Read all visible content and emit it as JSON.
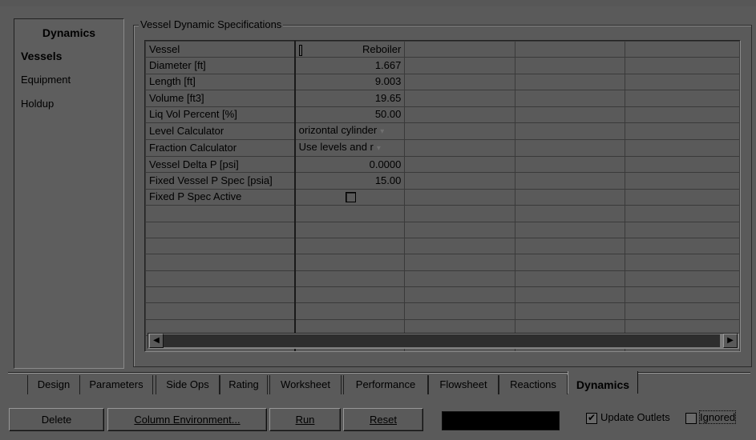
{
  "nav": {
    "header": "Dynamics",
    "items": [
      {
        "label": "Vessels",
        "selected": true
      },
      {
        "label": "Equipment",
        "selected": false
      },
      {
        "label": "Holdup",
        "selected": false
      }
    ]
  },
  "group": {
    "title": "Vessel Dynamic Specifications"
  },
  "grid": {
    "rows": [
      {
        "label": "Vessel",
        "value": "Reboiler"
      },
      {
        "label": "Diameter [ft]",
        "value": "1.667"
      },
      {
        "label": "Length [ft]",
        "value": "9.003"
      },
      {
        "label": "Volume [ft3]",
        "value": "19.65"
      },
      {
        "label": "Liq Vol Percent [%]",
        "value": "50.00"
      },
      {
        "label": "Level Calculator",
        "value": "orizontal cylinder"
      },
      {
        "label": "Fraction Calculator",
        "value": "Use levels and r"
      },
      {
        "label": "Vessel Delta P [psi]",
        "value": "0.0000"
      },
      {
        "label": "Fixed Vessel P Spec [psia]",
        "value": "15.00"
      },
      {
        "label": "Fixed P Spec Active",
        "value": ""
      }
    ],
    "fixed_p_spec_active": false
  },
  "tabs": [
    {
      "label": "Design"
    },
    {
      "label": "Parameters"
    },
    {
      "label": "Side Ops"
    },
    {
      "label": "Rating"
    },
    {
      "label": "Worksheet"
    },
    {
      "label": "Performance"
    },
    {
      "label": "Flowsheet"
    },
    {
      "label": "Reactions"
    },
    {
      "label": "Dynamics",
      "active": true
    }
  ],
  "buttons": {
    "delete": "Delete",
    "column_env": "Column Environment...",
    "run": "Run",
    "reset": "Reset"
  },
  "options": {
    "update_outlets_label": "Update Outlets",
    "update_outlets_checked": true,
    "ignored_label": "Ignored",
    "ignored_checked": false
  },
  "icons": {
    "dropdown": "▾",
    "scroll_left": "◀",
    "scroll_right": "▶",
    "check": "✔"
  }
}
